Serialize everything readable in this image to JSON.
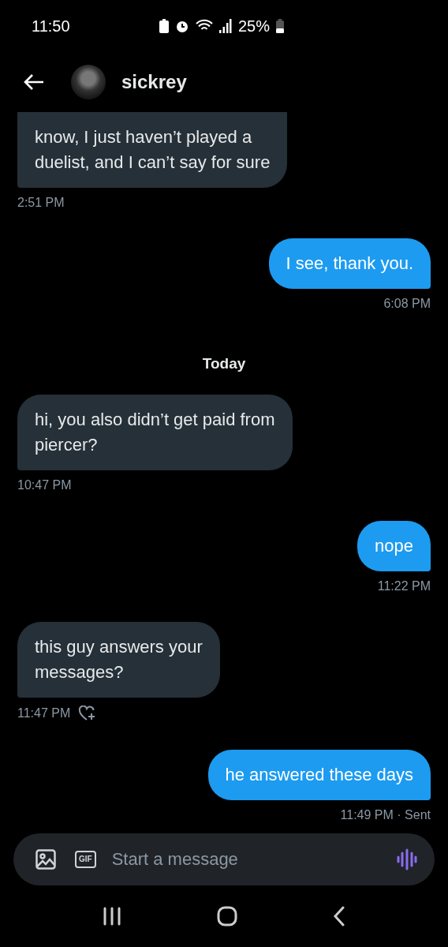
{
  "status_bar": {
    "time": "11:50",
    "battery": "25%"
  },
  "header": {
    "name": "sickrey"
  },
  "messages": [
    {
      "kind": "received",
      "lines": [
        "know, I just haven’t played a",
        "duelist, and I can’t say for sure"
      ],
      "time": "2:51 PM"
    },
    {
      "kind": "sent",
      "lines": [
        "I see, thank you."
      ],
      "time": "6:08 PM"
    },
    {
      "kind": "date",
      "label": "Today"
    },
    {
      "kind": "received",
      "lines": [
        "hi, you also didn’t get paid from",
        "piercer?"
      ],
      "time": "10:47 PM"
    },
    {
      "kind": "sent",
      "lines": [
        "nope"
      ],
      "time": "11:22 PM"
    },
    {
      "kind": "received",
      "lines": [
        "this guy answers your",
        "messages?"
      ],
      "time": "11:47 PM",
      "react": true
    },
    {
      "kind": "sent",
      "lines": [
        "he answered these days"
      ],
      "time": "11:49 PM · Sent"
    }
  ],
  "composer": {
    "gif_label": "GIF",
    "placeholder": "Start a message"
  }
}
